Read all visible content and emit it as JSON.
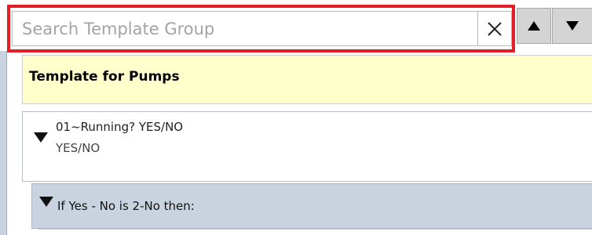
{
  "search": {
    "placeholder": "Search Template Group",
    "value": ""
  },
  "controls": {
    "clear_icon": "close-icon",
    "up_icon": "triangle-up-icon",
    "down_icon": "triangle-down-icon",
    "highlight_color": "#e31e26"
  },
  "template": {
    "title": "Template for Pumps"
  },
  "question": {
    "title": "01~Running? YES/NO",
    "answer": "YES/NO"
  },
  "condition": {
    "label": "If Yes - No is 2-No then:"
  }
}
